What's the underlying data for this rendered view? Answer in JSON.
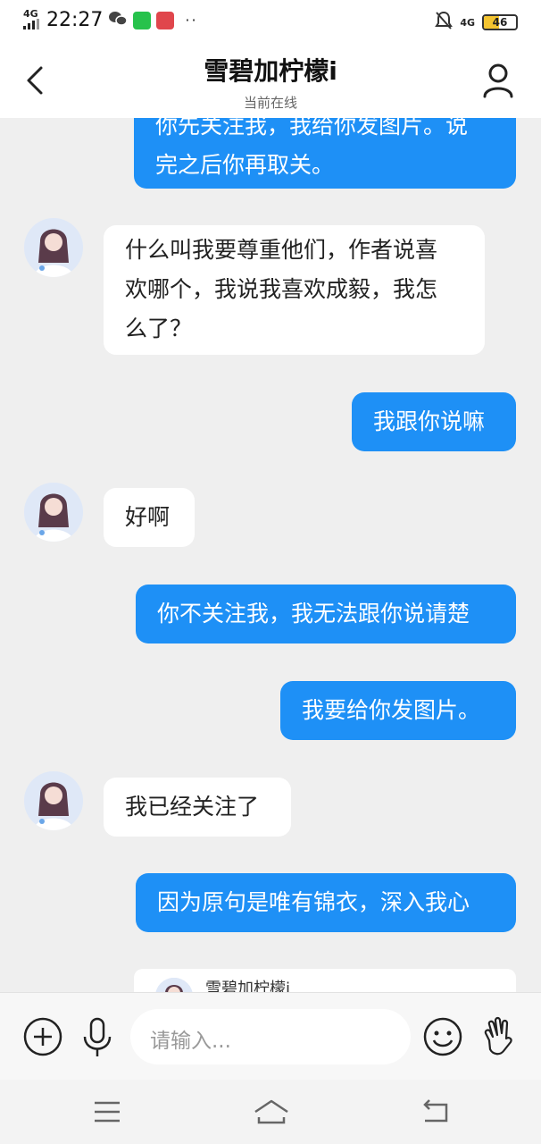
{
  "status_bar": {
    "network": "4G",
    "time": "22:27",
    "network_right": "4G",
    "battery": "46",
    "battery_level": 0.46,
    "more": "··"
  },
  "header": {
    "title": "雪碧加柠檬ⅰ",
    "subtitle": "当前在线"
  },
  "messages": [
    {
      "side": "right",
      "lines": [
        "你先关注我，我给你发图片。说",
        "完之后你再取关。"
      ]
    },
    {
      "side": "left",
      "lines": [
        "什么叫我要尊重他们，作者说喜",
        "欢哪个，我说我喜欢成毅，我怎",
        "么了？"
      ]
    },
    {
      "side": "right",
      "lines": [
        "我跟你说嘛"
      ]
    },
    {
      "side": "left",
      "lines": [
        "好啊"
      ]
    },
    {
      "side": "right",
      "lines": [
        "你不关注我，我无法跟你说请楚"
      ]
    },
    {
      "side": "right",
      "lines": [
        "我要给你发图片。"
      ]
    },
    {
      "side": "left",
      "lines": [
        "我已经关注了"
      ]
    },
    {
      "side": "right",
      "lines": [
        "因为原句是唯有锦衣，深入我心"
      ]
    }
  ],
  "partial_card": {
    "name": "雪碧加柠檬ⅰ"
  },
  "input": {
    "placeholder": "请输入..."
  },
  "colors": {
    "accent": "#1e90f6",
    "background": "#efefef",
    "battery": "#f4c430"
  }
}
